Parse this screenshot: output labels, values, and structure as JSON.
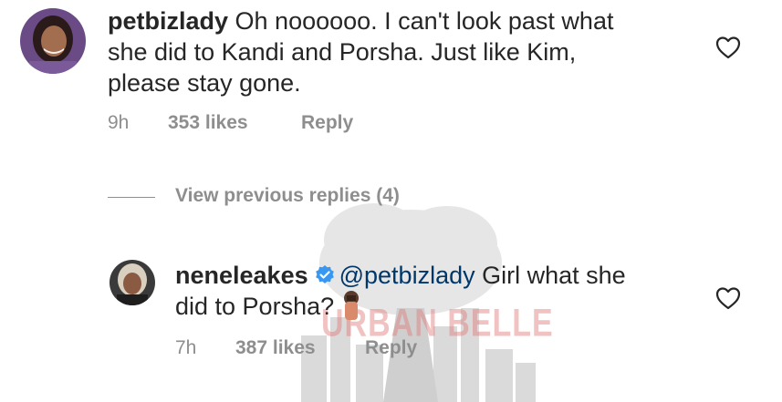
{
  "comments": [
    {
      "username": "petbizlady",
      "text_line1": " Oh noooooo.  I can't look past what",
      "text_line2": "she did to Kandi and Porsha. Just like Kim,",
      "text_line3": "please stay gone.",
      "time": "9h",
      "likes": "353 likes",
      "reply": "Reply"
    },
    {
      "username": "neneleakes",
      "mention": "@petbizlady",
      "text_line1_rest": " Girl what she",
      "text_line2": "did to Porsha?",
      "emoji": "nail-polish",
      "time": "7h",
      "likes": "387 likes",
      "reply": "Reply"
    }
  ],
  "view_replies_label": "View previous replies (4)",
  "watermark_text": "URBAN BELLE",
  "icons": {
    "like": "heart-outline-icon",
    "verified": "verified-badge-icon"
  },
  "colors": {
    "text": "#262626",
    "secondary": "#8e8e8e",
    "mention": "#00376b",
    "verified": "#3897f0"
  }
}
